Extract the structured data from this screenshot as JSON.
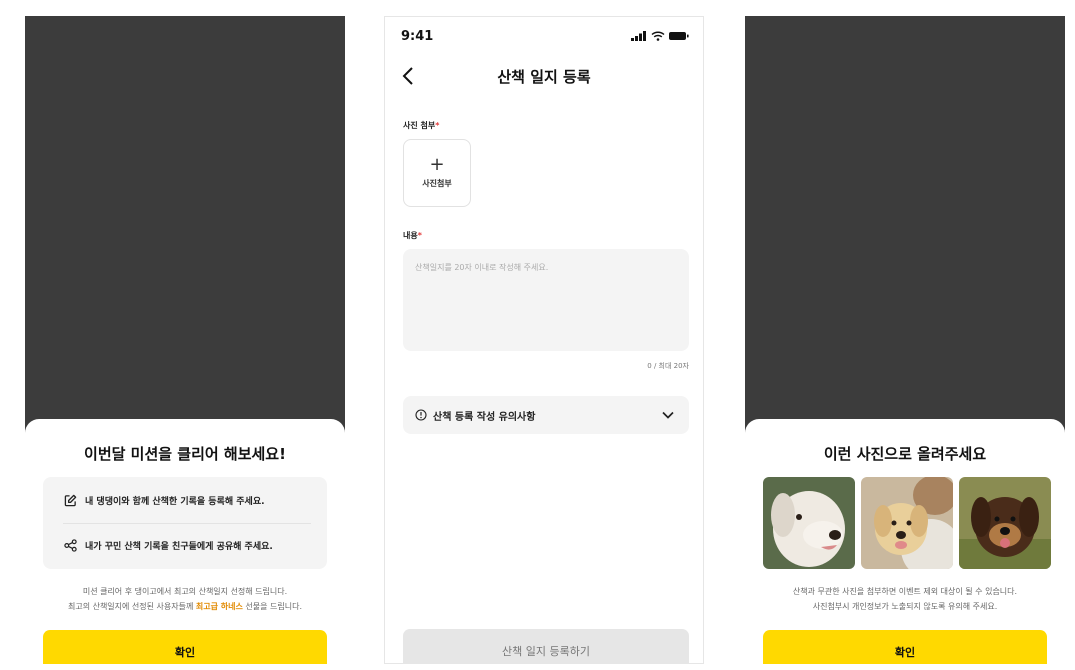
{
  "screen1": {
    "title": "이번달 미션을 클리어 해보세요!",
    "items": [
      {
        "icon": "edit-icon",
        "text": "내 댕댕이와 함께 산책한 기록을 등록해 주세요."
      },
      {
        "icon": "share-icon",
        "text": "내가 꾸민 산책 기록을 친구들에게 공유해 주세요."
      }
    ],
    "desc_line1": "미션 클리어 후 댕이고에서 최고의 산책일지 선정해 드립니다.",
    "desc_line2_a": "최고의 산책일지에 선정된 사용자들께 ",
    "desc_line2_hl": "최고급 하네스",
    "desc_line2_b": " 선물을 드립니다.",
    "confirm_label": "확인",
    "highlight_color": "#e28a00",
    "button_color": "#ffd900"
  },
  "screen2": {
    "status_time": "9:41",
    "nav_title": "산책 일지 등록",
    "photo_label": "사진 첨부",
    "required_mark": "*",
    "photo_add_plus": "+",
    "photo_add_label": "사진첨부",
    "content_label": "내용",
    "content_placeholder": "산책일지를 20자 이내로 작성해 주세요.",
    "counter": "0 / 최대 20자",
    "notice_label": "산책 등록 작성 유의사항",
    "submit_label": "산책 일지 등록하기"
  },
  "screen3": {
    "title": "이런 사진으로 올려주세요",
    "desc_line1": "산책과 무관한 사진을 첨부하면 이벤트 제외 대상이 될 수 있습니다.",
    "desc_line2": "사진첨부시 개인정보가 노출되지 않도록 유의해 주세요.",
    "confirm_label": "확인"
  }
}
